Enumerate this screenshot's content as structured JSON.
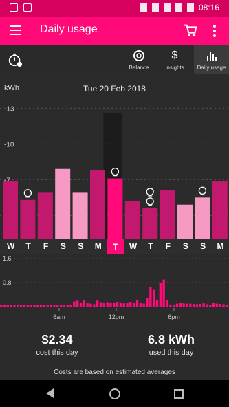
{
  "status_bar": {
    "time": "08:16"
  },
  "app_bar": {
    "title": "Daily usage"
  },
  "tabs": [
    {
      "label": "Balance",
      "icon": "gauge-icon"
    },
    {
      "label": "Insights",
      "icon": "dollar-icon"
    },
    {
      "label": "Daily usage",
      "icon": "bar-chart-icon"
    }
  ],
  "chart_header": {
    "unit": "kWh",
    "date": "Tue 20 Feb 2018"
  },
  "colors": {
    "accent": "#ff0a78",
    "bar_weekday": "#c2196f",
    "bar_weekend": "#f79ac3",
    "bar_selected": "#ff0a78"
  },
  "chart_data": [
    {
      "type": "bar",
      "ylabel": "kWh",
      "ylim": [
        2,
        14
      ],
      "yticks": [
        4,
        7,
        10,
        13
      ],
      "categories": [
        "W",
        "T",
        "F",
        "S",
        "S",
        "M",
        "T",
        "W",
        "T",
        "F",
        "S",
        "S",
        "M"
      ],
      "values": [
        6.9,
        5.3,
        5.9,
        7.9,
        5.9,
        7.8,
        7.1,
        5.2,
        4.6,
        6.1,
        4.9,
        5.5,
        6.9
      ],
      "weekend": [
        false,
        false,
        false,
        true,
        true,
        false,
        false,
        false,
        false,
        false,
        true,
        true,
        false
      ],
      "selected_index": 6,
      "annotations": [
        {
          "index": 1,
          "icon": "vacuum-icon"
        },
        {
          "index": 6,
          "icon": "washing-machine-icon"
        },
        {
          "index": 8,
          "icon": "vacuum-icon"
        },
        {
          "index": 8,
          "icon": "dishwasher-icon"
        },
        {
          "index": 11,
          "icon": "hairdryer-icon"
        }
      ]
    },
    {
      "type": "bar",
      "ylim": [
        0,
        1.6
      ],
      "yticks": [
        0.8,
        1.6
      ],
      "xticks": [
        "6am",
        "12pm",
        "6pm"
      ],
      "values": [
        0.05,
        0.07,
        0.07,
        0.06,
        0.06,
        0.07,
        0.06,
        0.06,
        0.07,
        0.07,
        0.06,
        0.06,
        0.07,
        0.06,
        0.06,
        0.07,
        0.06,
        0.06,
        0.06,
        0.07,
        0.06,
        0.07,
        0.17,
        0.2,
        0.12,
        0.22,
        0.13,
        0.1,
        0.08,
        0.2,
        0.15,
        0.13,
        0.15,
        0.12,
        0.13,
        0.16,
        0.14,
        0.11,
        0.12,
        0.16,
        0.13,
        0.21,
        0.13,
        0.1,
        0.28,
        0.64,
        0.56,
        0.23,
        0.78,
        0.9,
        0.22,
        0.07,
        0.06,
        0.1,
        0.12,
        0.11,
        0.1,
        0.1,
        0.09,
        0.08,
        0.09,
        0.11,
        0.08,
        0.07,
        0.12,
        0.1,
        0.09,
        0.08,
        0.07
      ]
    }
  ],
  "summary": {
    "cost": "$2.34",
    "cost_label": "cost this day",
    "usage": "6.8 kWh",
    "usage_label": "used this day",
    "note": "Costs are based on estimated averages"
  }
}
